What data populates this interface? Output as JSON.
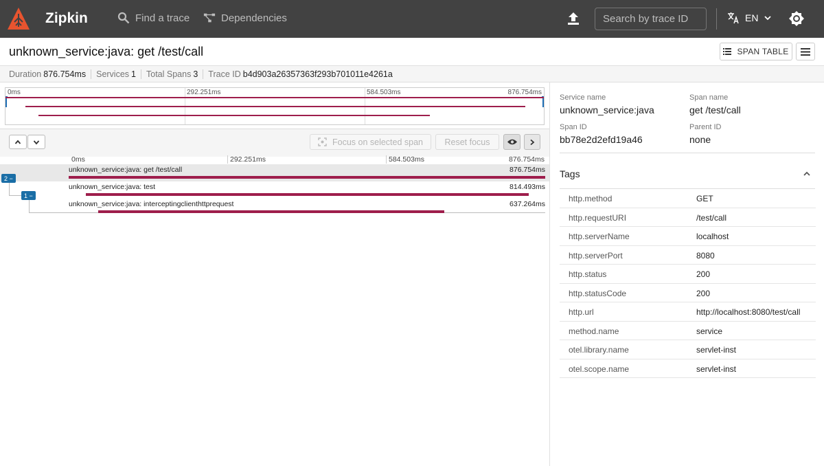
{
  "appbar": {
    "brand": "Zipkin",
    "nav": [
      {
        "label": "Find a trace",
        "icon": "search-icon"
      },
      {
        "label": "Dependencies",
        "icon": "dependencies-icon"
      }
    ],
    "search_placeholder": "Search by trace ID",
    "language": "EN"
  },
  "header": {
    "title": "unknown_service:java: get /test/call",
    "span_table_label": "SPAN TABLE"
  },
  "summary": {
    "duration_label": "Duration",
    "duration_value": "876.754ms",
    "services_label": "Services",
    "services_value": "1",
    "spans_label": "Total Spans",
    "spans_value": "3",
    "traceid_label": "Trace ID",
    "traceid_value": "b4d903a26357363f293b701011e4261a"
  },
  "minimap": {
    "ticks": [
      "0ms",
      "292.251ms",
      "584.503ms",
      "876.754ms"
    ]
  },
  "toolbar": {
    "focus_label": "Focus on selected span",
    "reset_label": "Reset focus"
  },
  "timeline": {
    "ticks": [
      "0ms",
      "292.251ms",
      "584.503ms",
      "876.754ms"
    ],
    "total_ms": 876.754,
    "spans": [
      {
        "label": "unknown_service:java: get /test/call",
        "duration": "876.754ms",
        "start_ms": 0,
        "duration_ms": 876.754,
        "badge": "2 −"
      },
      {
        "label": "unknown_service:java: test",
        "duration": "814.493ms",
        "start_ms": 32.0,
        "duration_ms": 814.493,
        "badge": "1 −"
      },
      {
        "label": "unknown_service:java: interceptingclienthttprequest",
        "duration": "637.264ms",
        "start_ms": 54.0,
        "duration_ms": 637.264,
        "badge": ""
      }
    ]
  },
  "detail": {
    "service_name_label": "Service name",
    "service_name": "unknown_service:java",
    "span_name_label": "Span name",
    "span_name": "get /test/call",
    "span_id_label": "Span ID",
    "span_id": "bb78e2d2efd19a46",
    "parent_id_label": "Parent ID",
    "parent_id": "none",
    "tags_title": "Tags",
    "tags": [
      {
        "key": "http.method",
        "value": "GET"
      },
      {
        "key": "http.requestURI",
        "value": "/test/call"
      },
      {
        "key": "http.serverName",
        "value": "localhost"
      },
      {
        "key": "http.serverPort",
        "value": "8080"
      },
      {
        "key": "http.status",
        "value": "200"
      },
      {
        "key": "http.statusCode",
        "value": "200"
      },
      {
        "key": "http.url",
        "value": "http://localhost:8080/test/call"
      },
      {
        "key": "method.name",
        "value": "service"
      },
      {
        "key": "otel.library.name",
        "value": "servlet-inst"
      },
      {
        "key": "otel.scope.name",
        "value": "servlet-inst"
      }
    ]
  },
  "colors": {
    "appbar": "#424242",
    "span_bar": "#9e1e4c",
    "badge": "#1a6ea6",
    "logo": "#e8542f"
  }
}
